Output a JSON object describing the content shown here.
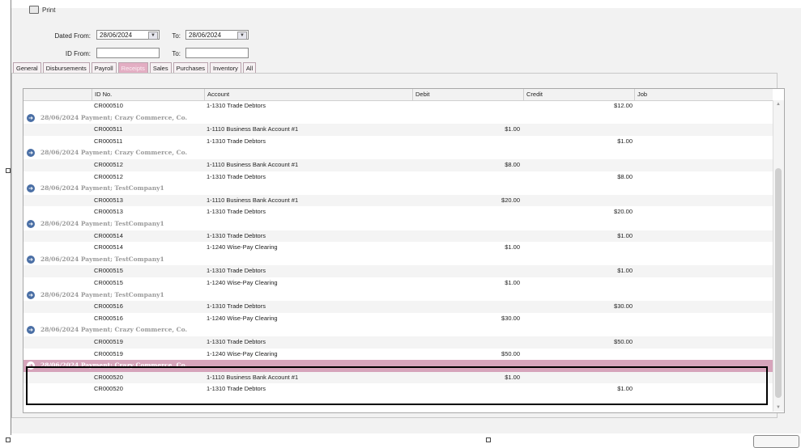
{
  "toolbar": {
    "print_label": "Print"
  },
  "filters": {
    "dated_from_label": "Dated From:",
    "dated_from_value": "28/06/2024",
    "to_label": "To:",
    "to_value": "28/06/2024",
    "id_from_label": "ID From:",
    "id_to_label": "To:"
  },
  "tabs": [
    {
      "label": "General",
      "active": false
    },
    {
      "label": "Disbursements",
      "active": false
    },
    {
      "label": "Payroll",
      "active": false
    },
    {
      "label": "Receipts",
      "active": true
    },
    {
      "label": "Sales",
      "active": false
    },
    {
      "label": "Purchases",
      "active": false
    },
    {
      "label": "Inventory",
      "active": false
    },
    {
      "label": "All",
      "active": false
    }
  ],
  "columns": [
    "ID No.",
    "Account",
    "Debit",
    "Credit",
    "Job"
  ],
  "rows": [
    {
      "type": "line",
      "id": "CR000510",
      "account": "1-1310  Trade Debtors",
      "debit": "",
      "credit": "$12.00"
    },
    {
      "type": "group",
      "text": "28/06/2024  Payment; Crazy Commerce, Co."
    },
    {
      "type": "line",
      "id": "CR000511",
      "account": "1-1110  Business Bank Account #1",
      "debit": "$1.00",
      "credit": ""
    },
    {
      "type": "line",
      "id": "CR000511",
      "account": "1-1310  Trade Debtors",
      "debit": "",
      "credit": "$1.00"
    },
    {
      "type": "group",
      "text": "28/06/2024  Payment; Crazy Commerce, Co."
    },
    {
      "type": "line",
      "id": "CR000512",
      "account": "1-1110  Business Bank Account #1",
      "debit": "$8.00",
      "credit": ""
    },
    {
      "type": "line",
      "id": "CR000512",
      "account": "1-1310  Trade Debtors",
      "debit": "",
      "credit": "$8.00"
    },
    {
      "type": "group",
      "text": "28/06/2024  Payment; TestCompany1"
    },
    {
      "type": "line",
      "id": "CR000513",
      "account": "1-1110  Business Bank Account #1",
      "debit": "$20.00",
      "credit": ""
    },
    {
      "type": "line",
      "id": "CR000513",
      "account": "1-1310  Trade Debtors",
      "debit": "",
      "credit": "$20.00"
    },
    {
      "type": "group",
      "text": "28/06/2024  Payment; TestCompany1"
    },
    {
      "type": "line",
      "id": "CR000514",
      "account": "1-1310  Trade Debtors",
      "debit": "",
      "credit": "$1.00"
    },
    {
      "type": "line",
      "id": "CR000514",
      "account": "1-1240  Wise-Pay Clearing",
      "debit": "$1.00",
      "credit": ""
    },
    {
      "type": "group",
      "text": "28/06/2024  Payment; TestCompany1"
    },
    {
      "type": "line",
      "id": "CR000515",
      "account": "1-1310  Trade Debtors",
      "debit": "",
      "credit": "$1.00"
    },
    {
      "type": "line",
      "id": "CR000515",
      "account": "1-1240  Wise-Pay Clearing",
      "debit": "$1.00",
      "credit": ""
    },
    {
      "type": "group",
      "text": "28/06/2024  Payment; TestCompany1"
    },
    {
      "type": "line",
      "id": "CR000516",
      "account": "1-1310  Trade Debtors",
      "debit": "",
      "credit": "$30.00"
    },
    {
      "type": "line",
      "id": "CR000516",
      "account": "1-1240  Wise-Pay Clearing",
      "debit": "$30.00",
      "credit": ""
    },
    {
      "type": "group",
      "text": "28/06/2024  Payment; Crazy Commerce, Co."
    },
    {
      "type": "line",
      "id": "CR000519",
      "account": "1-1310  Trade Debtors",
      "debit": "",
      "credit": "$50.00"
    },
    {
      "type": "line",
      "id": "CR000519",
      "account": "1-1240  Wise-Pay Clearing",
      "debit": "$50.00",
      "credit": ""
    },
    {
      "type": "group",
      "text": "28/06/2024  Payment; Crazy Commerce, Co.",
      "selected": true
    },
    {
      "type": "line",
      "id": "CR000520",
      "account": "1-1110  Business Bank Account #1",
      "debit": "$1.00",
      "credit": ""
    },
    {
      "type": "line",
      "id": "CR000520",
      "account": "1-1310  Trade Debtors",
      "debit": "",
      "credit": "$1.00"
    }
  ]
}
